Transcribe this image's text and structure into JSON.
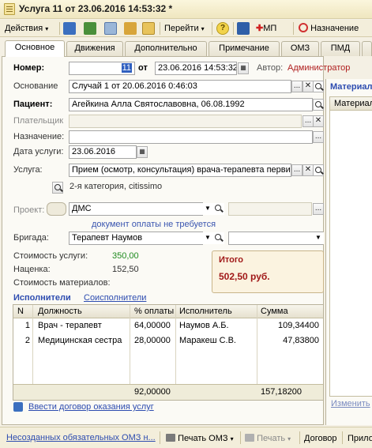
{
  "window": {
    "title": "Услуга 11 от 23.06.2016 14:53:32 *"
  },
  "toolbar": {
    "actions_label": "Действия",
    "goto_label": "Перейти",
    "mp_label": "МП",
    "assignment_label": "Назначение"
  },
  "tabs": [
    "Основное",
    "Движения",
    "Дополнительно",
    "Примечание",
    "ОМЗ",
    "ПМД"
  ],
  "form": {
    "number_label": "Номер:",
    "number_value": "11",
    "from_label": "от",
    "date_value": "23.06.2016 14:53:32",
    "author_label": "Автор:",
    "author_value": "Администратор",
    "basis_label": "Основание",
    "basis_value": "Случай 1 от 20.06.2016 0:46:03",
    "patient_label": "Пациент:",
    "patient_value": "Агейкина Алла Святославовна, 06.08.1992",
    "payer_label": "Плательщик",
    "payer_value": "",
    "assignment_label": "Назначение:",
    "assignment_value": "",
    "service_date_label": "Дата услуги:",
    "service_date_value": "23.06.2016",
    "service_label": "Услуга:",
    "service_value": "Прием (осмотр, консультация) врача-терапевта первично",
    "category_text": "2-я категория, citissimo",
    "project_label": "Проект:",
    "project_value": "ДМС",
    "payment_note": "документ оплаты не требуется",
    "brigade_label": "Бригада:",
    "brigade_value": "Терапевт Наумов",
    "cost_label": "Стоимость услуги:",
    "cost_value": "350,00",
    "markup_label": "Наценка:",
    "markup_value": "152,50",
    "materials_cost_label": "Стоимость материалов:",
    "materials_cost_value": ""
  },
  "total": {
    "label": "Итого",
    "value": "502,50 руб."
  },
  "performers": {
    "tab_active": "Исполнители",
    "tab_other": "Соисполнители",
    "columns": [
      "N",
      "Должность",
      "% оплаты",
      "Исполнитель",
      "Сумма"
    ],
    "rows": [
      [
        "1",
        "Врач - терапевт",
        "64,00000",
        "Наумов А.Б.",
        "109,34400"
      ],
      [
        "2",
        "Медицинская сестра",
        "28,00000",
        "Маракеш С.В.",
        "47,83800"
      ]
    ],
    "footer": {
      "percent": "92,00000",
      "sum": "157,18200"
    }
  },
  "contract_link": "Ввести договор оказания услуг",
  "right_panel": {
    "title": "Материал",
    "col": "Материал",
    "edit_link": "Изменить"
  },
  "statusbar": {
    "unfilled_omz": "Несозданных обязательных ОМЗ н...",
    "print_omz": "Печать ОМЗ",
    "print": "Печать",
    "contract": "Договор",
    "apply": "Прило"
  }
}
